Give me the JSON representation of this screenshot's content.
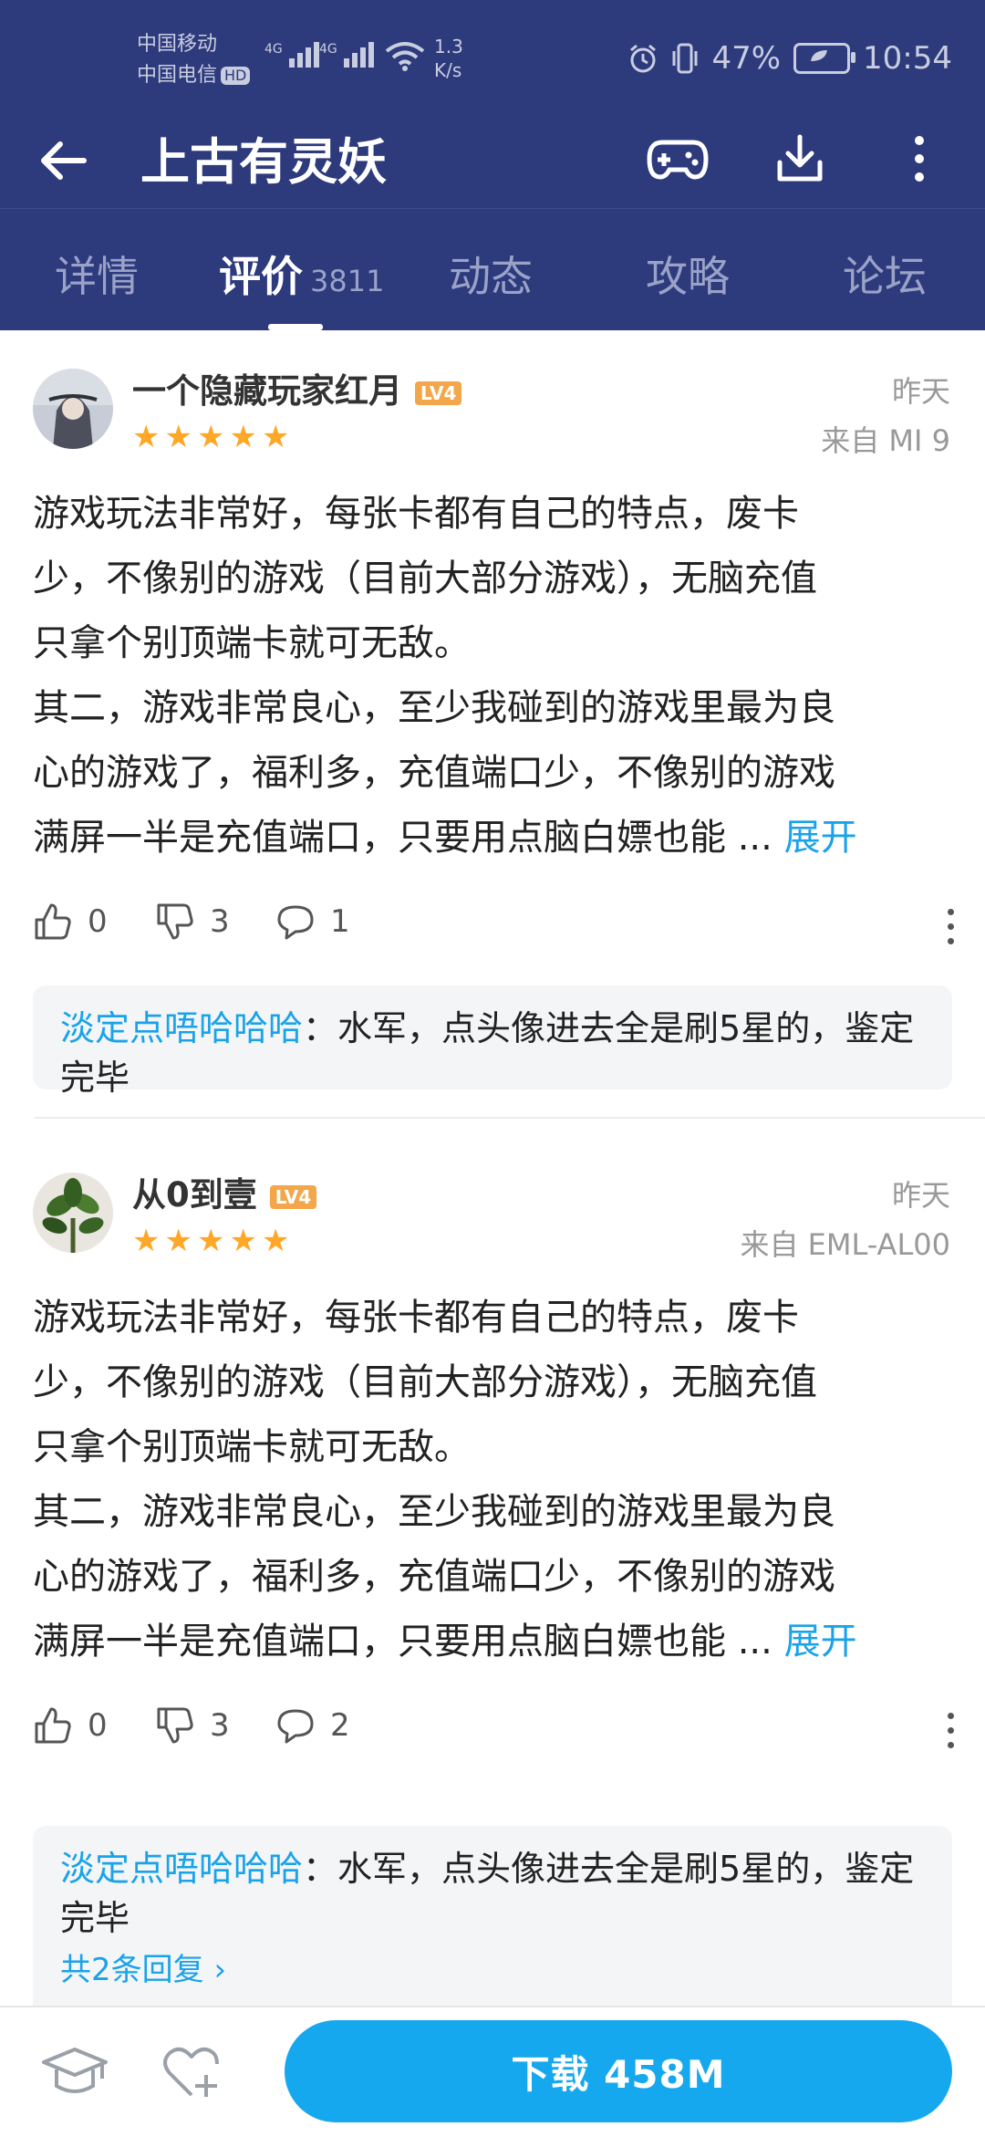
{
  "status_bar": {
    "carrier1": "中国移动",
    "carrier2": "中国电信",
    "hd": "HD",
    "net1": "4G",
    "net2": "4G",
    "speed_value": "1.3",
    "speed_unit": "K/s",
    "battery": "47%",
    "time": "10:54"
  },
  "header": {
    "title": "上古有灵妖"
  },
  "tabs": [
    {
      "label": "详情"
    },
    {
      "label": "评价",
      "count": "3811"
    },
    {
      "label": "动态"
    },
    {
      "label": "攻略"
    },
    {
      "label": "论坛"
    }
  ],
  "reviews": [
    {
      "username": "一个隐藏玩家红月",
      "level": "LV4",
      "rating": 5,
      "time": "昨天",
      "device": "来自 MI 9",
      "lines": [
        "游戏玩法非常好，每张卡都有自己的特点，废卡",
        "少，不像别的游戏（目前大部分游戏），无脑充值",
        "只拿个别顶端卡就可无敌。",
        "其二，游戏非常良心，至少我碰到的游戏里最为良",
        "心的游戏了，福利多，充值端口少，不像别的游戏",
        "满屏一半是充值端口，只要用点脑白嫖也能 ..."
      ],
      "expand": "展开",
      "likes": "0",
      "dislikes": "3",
      "comments": "1",
      "reply_name": "淡定点唔哈哈哈",
      "reply_text": "：水军，点头像进去全是刷5星的，鉴定完毕"
    },
    {
      "username": "从0到壹",
      "level": "LV4",
      "rating": 5,
      "time": "昨天",
      "device": "来自 EML-AL00",
      "lines": [
        "游戏玩法非常好，每张卡都有自己的特点，废卡",
        "少，不像别的游戏（目前大部分游戏），无脑充值",
        "只拿个别顶端卡就可无敌。",
        "其二，游戏非常良心，至少我碰到的游戏里最为良",
        "心的游戏了，福利多，充值端口少，不像别的游戏",
        "满屏一半是充值端口，只要用点脑白嫖也能 ..."
      ],
      "expand": "展开",
      "likes": "0",
      "dislikes": "3",
      "comments": "2",
      "reply_name": "淡定点唔哈哈哈",
      "reply_text": "：水军，点头像进去全是刷5星的，鉴定完毕",
      "reply_more": "共2条回复 ›"
    }
  ],
  "bottom_bar": {
    "download_label": "下载 458M"
  },
  "colors": {
    "header_bg": "#2d3a7c",
    "accent": "#1aa3e8",
    "download_bg": "#16a8ee",
    "star": "#ffa726",
    "level_badge": "#f4a74a"
  }
}
